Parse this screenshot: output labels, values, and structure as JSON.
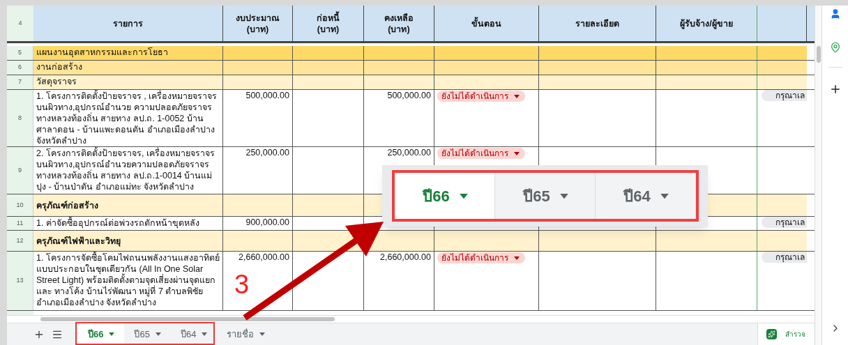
{
  "header": {
    "number": "4",
    "columns": [
      "รายการ",
      "งบประมาณ\n(บาท)",
      "ก่อหนี้\n(บาท)",
      "คงเหลือ\n(บาท)",
      "ขั้นตอน",
      "รายละเอียด",
      "ผู้รับจ้าง/ผู้ขาย"
    ]
  },
  "rows": [
    {
      "number": "5",
      "kind": "plan",
      "item": "แผนงานอุตสาหกรรมและการโยธา"
    },
    {
      "number": "6",
      "kind": "work",
      "item": "งานก่อสร้าง"
    },
    {
      "number": "7",
      "kind": "category",
      "item": "วัสดุจราจร"
    },
    {
      "number": "8",
      "kind": "item",
      "item": "1. โครงการติดตั้งป้ายจราจร , เครื่องหมายจราจร บนผิวทาง,อุปกรณ์อำนวย ความปลอดภัยจราจร ทางหลวงท้องถิ่น สายทาง ลป.ถ. 1-0052 บ้านศาลาดอน - บ้านแพะดอนตัน อำเภอเมืองลำปาง จังหวัดลำปาง",
      "budget": "500,000.00",
      "remaining": "500,000.00",
      "status": "ยังไม่ได้ดำเนินการ",
      "column_9": "กรุณาเล"
    },
    {
      "number": "9",
      "kind": "item",
      "item": "2. โครงการติดตั้งป้ายจราจร, เครื่องหมายจราจร บนผิวทาง,อุปกรณ์อำนวยความปลอดภัยจราจร ทางหลวงท้องถิ่น สายทาง ลป.ถ.1-0014 บ้านแม่ปุง -  บ้านป่าตัน อำเภอแม่ทะ จังหวัดลำปาง",
      "budget": "250,000.00",
      "remaining": "250,000.00",
      "status": "ยังไม่ได้ดำเนินการ"
    },
    {
      "number": "10",
      "kind": "equipment",
      "item": "ครุภัณฑ์ก่อสร้าง"
    },
    {
      "number": "11",
      "kind": "item",
      "item": "1. ค่าจัดซื้ออุปกรณ์ต่อพ่วงรถตักหน้าขุดหลัง",
      "budget": "900,000.00",
      "column_9": "กรุณาเล"
    },
    {
      "number": "12",
      "kind": "equipment",
      "item": "ครุภัณฑ์ไฟฟ้าและวิทยุ"
    },
    {
      "number": "13",
      "kind": "item",
      "item": "1. โครงการจัดซื้อโคมไฟถนนพลังงานแสงอาทิตย์ แบบประกอบในชุดเดียวกัน (All In One Solar Street Light) พร้อมติดตั้งตามจุดเสี่ยงผ่านจุดแยก และ ทางโค้ง บ้านไร่พัฒนา หมู่ที่ 7 ตำบลพิชัย อำเภอเมืองลำปาง จังหวัดลำปาง",
      "budget": "2,660,000.00",
      "remaining": "2,660,000.00",
      "status": "ยังไม่ได้ดำเนินการ",
      "column_9": "กรุณาเล"
    }
  ],
  "sheet_tabs": [
    {
      "label": "ปี66",
      "selected": true
    },
    {
      "label": "ปี65",
      "selected": false
    },
    {
      "label": "ปี64",
      "selected": false
    },
    {
      "label": "รายชื่อ",
      "selected": false
    }
  ],
  "explore_button": "สำรวจ",
  "callout": {
    "number": "3",
    "tabs": [
      {
        "label": "ปี66",
        "selected": true
      },
      {
        "label": "ปี65",
        "selected": false
      },
      {
        "label": "ปี64",
        "selected": false
      }
    ]
  }
}
